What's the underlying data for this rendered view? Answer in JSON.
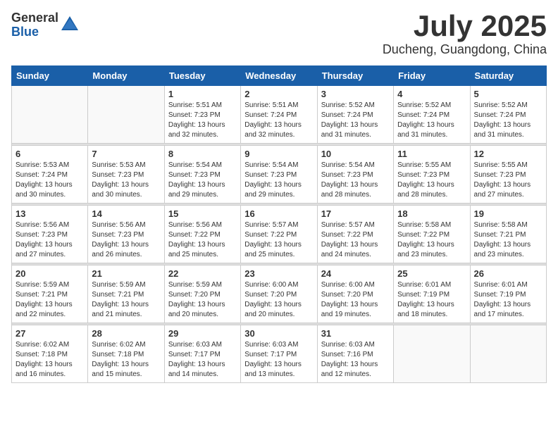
{
  "logo": {
    "general": "General",
    "blue": "Blue"
  },
  "title": "July 2025",
  "location": "Ducheng, Guangdong, China",
  "days_of_week": [
    "Sunday",
    "Monday",
    "Tuesday",
    "Wednesday",
    "Thursday",
    "Friday",
    "Saturday"
  ],
  "weeks": [
    [
      {
        "day": "",
        "info": ""
      },
      {
        "day": "",
        "info": ""
      },
      {
        "day": "1",
        "info": "Sunrise: 5:51 AM\nSunset: 7:23 PM\nDaylight: 13 hours and 32 minutes."
      },
      {
        "day": "2",
        "info": "Sunrise: 5:51 AM\nSunset: 7:24 PM\nDaylight: 13 hours and 32 minutes."
      },
      {
        "day": "3",
        "info": "Sunrise: 5:52 AM\nSunset: 7:24 PM\nDaylight: 13 hours and 31 minutes."
      },
      {
        "day": "4",
        "info": "Sunrise: 5:52 AM\nSunset: 7:24 PM\nDaylight: 13 hours and 31 minutes."
      },
      {
        "day": "5",
        "info": "Sunrise: 5:52 AM\nSunset: 7:24 PM\nDaylight: 13 hours and 31 minutes."
      }
    ],
    [
      {
        "day": "6",
        "info": "Sunrise: 5:53 AM\nSunset: 7:24 PM\nDaylight: 13 hours and 30 minutes."
      },
      {
        "day": "7",
        "info": "Sunrise: 5:53 AM\nSunset: 7:23 PM\nDaylight: 13 hours and 30 minutes."
      },
      {
        "day": "8",
        "info": "Sunrise: 5:54 AM\nSunset: 7:23 PM\nDaylight: 13 hours and 29 minutes."
      },
      {
        "day": "9",
        "info": "Sunrise: 5:54 AM\nSunset: 7:23 PM\nDaylight: 13 hours and 29 minutes."
      },
      {
        "day": "10",
        "info": "Sunrise: 5:54 AM\nSunset: 7:23 PM\nDaylight: 13 hours and 28 minutes."
      },
      {
        "day": "11",
        "info": "Sunrise: 5:55 AM\nSunset: 7:23 PM\nDaylight: 13 hours and 28 minutes."
      },
      {
        "day": "12",
        "info": "Sunrise: 5:55 AM\nSunset: 7:23 PM\nDaylight: 13 hours and 27 minutes."
      }
    ],
    [
      {
        "day": "13",
        "info": "Sunrise: 5:56 AM\nSunset: 7:23 PM\nDaylight: 13 hours and 27 minutes."
      },
      {
        "day": "14",
        "info": "Sunrise: 5:56 AM\nSunset: 7:23 PM\nDaylight: 13 hours and 26 minutes."
      },
      {
        "day": "15",
        "info": "Sunrise: 5:56 AM\nSunset: 7:22 PM\nDaylight: 13 hours and 25 minutes."
      },
      {
        "day": "16",
        "info": "Sunrise: 5:57 AM\nSunset: 7:22 PM\nDaylight: 13 hours and 25 minutes."
      },
      {
        "day": "17",
        "info": "Sunrise: 5:57 AM\nSunset: 7:22 PM\nDaylight: 13 hours and 24 minutes."
      },
      {
        "day": "18",
        "info": "Sunrise: 5:58 AM\nSunset: 7:22 PM\nDaylight: 13 hours and 23 minutes."
      },
      {
        "day": "19",
        "info": "Sunrise: 5:58 AM\nSunset: 7:21 PM\nDaylight: 13 hours and 23 minutes."
      }
    ],
    [
      {
        "day": "20",
        "info": "Sunrise: 5:59 AM\nSunset: 7:21 PM\nDaylight: 13 hours and 22 minutes."
      },
      {
        "day": "21",
        "info": "Sunrise: 5:59 AM\nSunset: 7:21 PM\nDaylight: 13 hours and 21 minutes."
      },
      {
        "day": "22",
        "info": "Sunrise: 5:59 AM\nSunset: 7:20 PM\nDaylight: 13 hours and 20 minutes."
      },
      {
        "day": "23",
        "info": "Sunrise: 6:00 AM\nSunset: 7:20 PM\nDaylight: 13 hours and 20 minutes."
      },
      {
        "day": "24",
        "info": "Sunrise: 6:00 AM\nSunset: 7:20 PM\nDaylight: 13 hours and 19 minutes."
      },
      {
        "day": "25",
        "info": "Sunrise: 6:01 AM\nSunset: 7:19 PM\nDaylight: 13 hours and 18 minutes."
      },
      {
        "day": "26",
        "info": "Sunrise: 6:01 AM\nSunset: 7:19 PM\nDaylight: 13 hours and 17 minutes."
      }
    ],
    [
      {
        "day": "27",
        "info": "Sunrise: 6:02 AM\nSunset: 7:18 PM\nDaylight: 13 hours and 16 minutes."
      },
      {
        "day": "28",
        "info": "Sunrise: 6:02 AM\nSunset: 7:18 PM\nDaylight: 13 hours and 15 minutes."
      },
      {
        "day": "29",
        "info": "Sunrise: 6:03 AM\nSunset: 7:17 PM\nDaylight: 13 hours and 14 minutes."
      },
      {
        "day": "30",
        "info": "Sunrise: 6:03 AM\nSunset: 7:17 PM\nDaylight: 13 hours and 13 minutes."
      },
      {
        "day": "31",
        "info": "Sunrise: 6:03 AM\nSunset: 7:16 PM\nDaylight: 13 hours and 12 minutes."
      },
      {
        "day": "",
        "info": ""
      },
      {
        "day": "",
        "info": ""
      }
    ]
  ]
}
